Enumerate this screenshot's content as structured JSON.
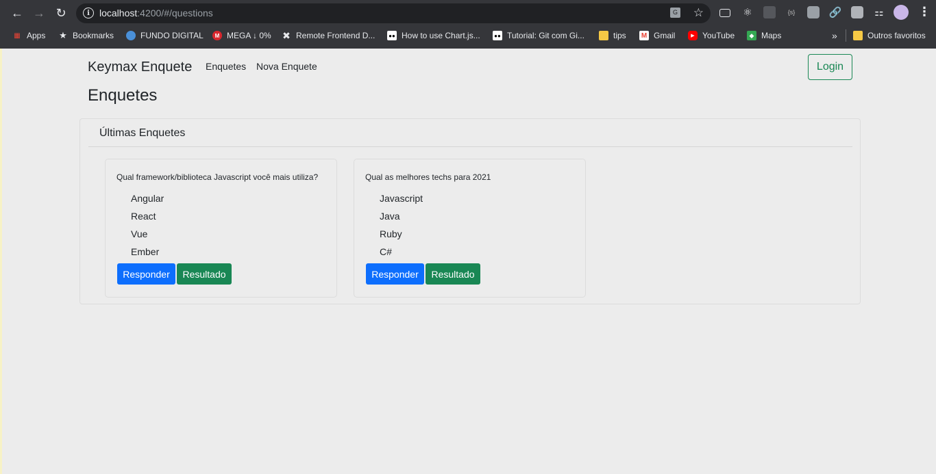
{
  "browser": {
    "url_host": "localhost",
    "url_rest": ":4200/#/questions",
    "bookmarks": [
      {
        "label": "Apps",
        "icon": "apps-grid-icon",
        "color": "#ea4335"
      },
      {
        "label": "Bookmarks",
        "icon": "star-icon",
        "color": "#e8eaed"
      },
      {
        "label": "FUNDO DIGITAL",
        "icon": "fundo-digital-icon",
        "color": "#4a90d9"
      },
      {
        "label": "MEGA ↓ 0%",
        "icon": "mega-icon",
        "color": "#d9272e"
      },
      {
        "label": "Remote Frontend D...",
        "icon": "x-icon",
        "color": "#e8eaed"
      },
      {
        "label": "How to use Chart.js...",
        "icon": "medium-icon",
        "color": "#ffffff"
      },
      {
        "label": "Tutorial: Git com Gi...",
        "icon": "medium-icon",
        "color": "#ffffff"
      },
      {
        "label": "tips",
        "icon": "folder-icon",
        "color": "#f6c945"
      },
      {
        "label": "Gmail",
        "icon": "gmail-icon",
        "color": "#ea4335"
      },
      {
        "label": "YouTube",
        "icon": "youtube-icon",
        "color": "#ff0000"
      },
      {
        "label": "Maps",
        "icon": "maps-icon",
        "color": "#34a853"
      }
    ],
    "overflow_label": "»",
    "other_bookmarks": "Outros favoritos"
  },
  "navbar": {
    "brand": "Keymax Enquete",
    "links": [
      "Enquetes",
      "Nova Enquete"
    ],
    "login_label": "Login"
  },
  "page": {
    "title": "Enquetes",
    "panel_title": "Últimas Enquetes"
  },
  "polls": [
    {
      "question": "Qual framework/biblioteca Javascript você mais utiliza?",
      "options": [
        "Angular",
        "React",
        "Vue",
        "Ember"
      ],
      "respond_label": "Responder",
      "result_label": "Resultado"
    },
    {
      "question": "Qual as melhores techs para 2021",
      "options": [
        "Javascript",
        "Java",
        "Ruby",
        "C#"
      ],
      "respond_label": "Responder",
      "result_label": "Resultado"
    }
  ],
  "colors": {
    "primary": "#0d6efd",
    "success": "#198754",
    "background": "#ececec"
  }
}
